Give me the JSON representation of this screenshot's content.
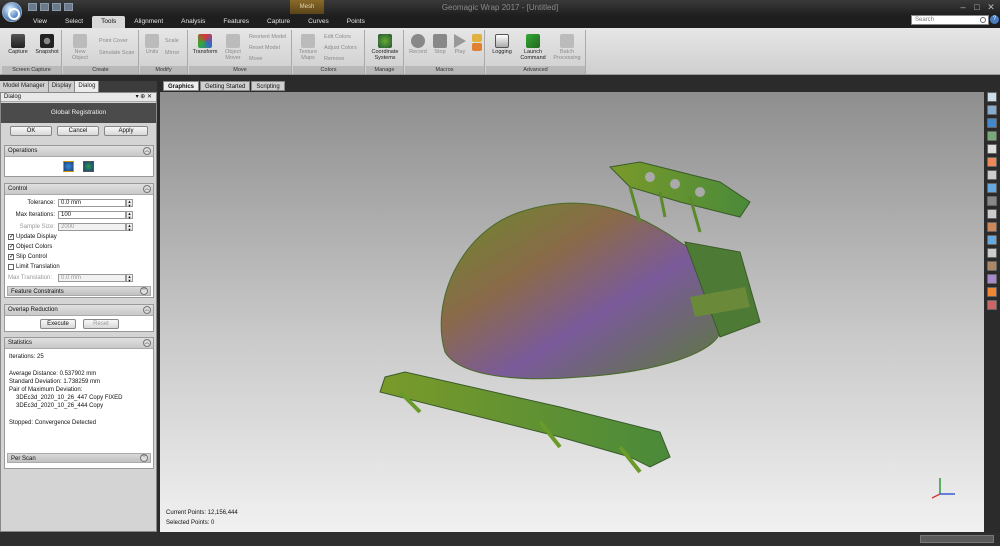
{
  "window": {
    "title": "Geomagic Wrap 2017 - [Untitled]",
    "contextual_tab": "Mesh"
  },
  "menu_tabs": [
    "View",
    "Select",
    "Tools",
    "Alignment",
    "Analysis",
    "Features",
    "Capture",
    "Curves",
    "Points"
  ],
  "active_tab": "Tools",
  "search": {
    "placeholder": "Search"
  },
  "ribbon": {
    "screen_capture": {
      "label": "Screen Capture",
      "capture": "Capture",
      "snapshot": "Snapshot"
    },
    "create": {
      "label": "Create",
      "new_object": "New Object",
      "point_cover": "Point Cover",
      "simulate_scan": "Simulate Scan"
    },
    "modify": {
      "label": "Modify",
      "units": "Units",
      "scale": "Scale",
      "mirror": "Mirror"
    },
    "move": {
      "label": "Move",
      "transform": "Transform",
      "object_mover": "Object Mover",
      "reorient_model": "Reorient Model",
      "reset_model": "Reset Model",
      "move_dd": "Move"
    },
    "colors": {
      "label": "Colors",
      "texture_maps": "Texture Maps",
      "edit_colors": "Edit Colors",
      "adjust_colors": "Adjust Colors",
      "remove": "Remove"
    },
    "manage": {
      "label": "Manage",
      "coord_systems": "Coordinate Systems"
    },
    "macros": {
      "label": "Macros",
      "record": "Record",
      "stop": "Stop",
      "play": "Play"
    },
    "advanced": {
      "label": "Advanced",
      "logging": "Logging",
      "launch_command": "Launch Command",
      "batch_processing": "Batch Processing"
    }
  },
  "panel_tabs": [
    "Model Manager",
    "Display",
    "Dialog"
  ],
  "panel": {
    "header": "Dialog",
    "dialog_title": "Global Registration",
    "ok": "OK",
    "cancel": "Cancel",
    "apply": "Apply",
    "operations": "Operations",
    "control": "Control",
    "tolerance_label": "Tolerance:",
    "tolerance": "0.0 mm",
    "max_iter_label": "Max Iterations:",
    "max_iter": "100",
    "sample_size_label": "Sample Size:",
    "sample_size": "2000",
    "update_display": "Update Display",
    "object_colors": "Object Colors",
    "slip_control": "Slip Control",
    "limit_translation": "Limit Translation",
    "max_translation_label": "Max Translation:",
    "max_translation": "0.0 mm",
    "feature_constraints": "Feature Constraints",
    "overlap_reduction": "Overlap Reduction",
    "execute": "Execute",
    "reset": "Reset",
    "statistics": "Statistics",
    "iterations": "Iterations: 25",
    "avg_distance": "Average Distance: 0.537902 mm",
    "std_dev": "Standard Deviation: 1.738259 mm",
    "pair_max": "Pair of Maximum Deviation:",
    "pair_a": "3DEc3d_2020_10_26_447 Copy FIXED",
    "pair_b": "3DEc3d_2020_10_26_444 Copy",
    "stopped": "Stopped: Convergence Detected",
    "per_scan": "Per Scan"
  },
  "view_tabs": [
    "Graphics",
    "Getting Started",
    "Scripting"
  ],
  "viewport": {
    "current_points": "Current Points: 12,156,444",
    "selected_points": "Selected Points: 0"
  }
}
